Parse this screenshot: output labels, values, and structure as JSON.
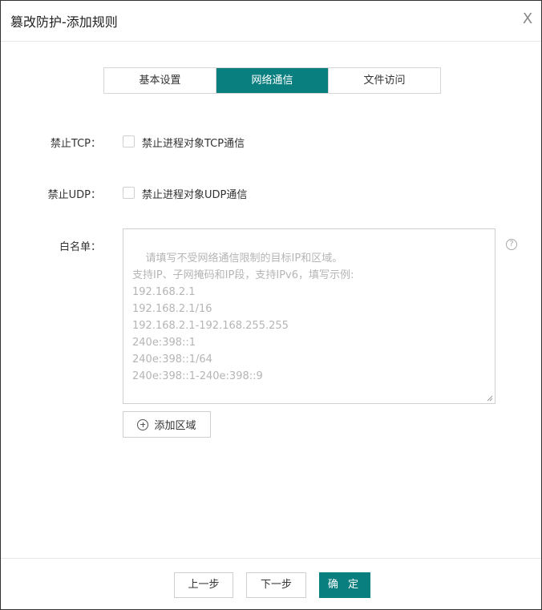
{
  "dialog": {
    "title": "篡改防护-添加规则",
    "close_label": "X"
  },
  "tabs": [
    {
      "label": "基本设置",
      "active": false
    },
    {
      "label": "网络通信",
      "active": true
    },
    {
      "label": "文件访问",
      "active": false
    }
  ],
  "tcp": {
    "label": "禁止TCP：",
    "checkbox_text": "禁止进程对象TCP通信",
    "checked": false
  },
  "udp": {
    "label": "禁止UDP：",
    "checkbox_text": "禁止进程对象UDP通信",
    "checked": false
  },
  "whitelist": {
    "label": "白名单：",
    "value": "",
    "placeholder": "请填写不受网络通信限制的目标IP和区域。\n支持IP、子网掩码和IP段，支持IPv6，填写示例:\n192.168.2.1\n192.168.2.1/16\n192.168.2.1-192.168.255.255\n240e:398::1\n240e:398::1/64\n240e:398::1-240e:398::9",
    "help_glyph": "?",
    "add_region_label": "添加区域"
  },
  "footer": {
    "prev_label": "上一步",
    "next_label": "下一步",
    "confirm_label": "确 定"
  },
  "colors": {
    "accent": "#0a7f80"
  },
  "icons": {
    "close": "close-icon",
    "help": "help-circle-icon",
    "add": "plus-circle-icon",
    "resize": "resize-handle-icon"
  }
}
